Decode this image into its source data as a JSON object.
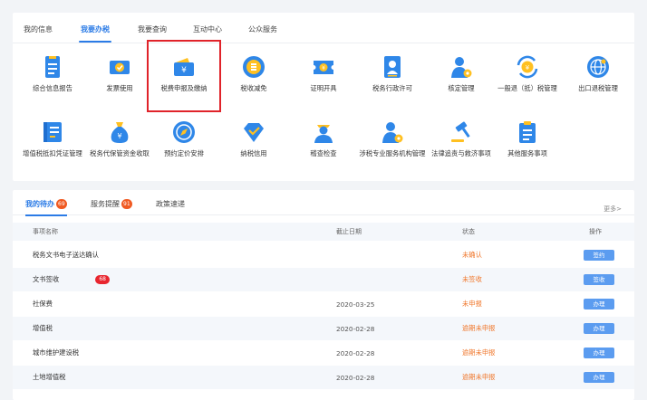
{
  "tabs": [
    "我的信息",
    "我要办税",
    "我要查询",
    "互动中心",
    "公众服务"
  ],
  "active_tab": 1,
  "services": [
    {
      "label": "综合信息报告",
      "icon": "report-doc-icon"
    },
    {
      "label": "发票使用",
      "icon": "invoice-icon"
    },
    {
      "label": "税费申报及缴纳",
      "icon": "wallet-yuan-icon"
    },
    {
      "label": "税收减免",
      "icon": "coin-stack-icon"
    },
    {
      "label": "证明开具",
      "icon": "certificate-icon"
    },
    {
      "label": "税务行政许可",
      "icon": "id-badge-icon"
    },
    {
      "label": "核定管理",
      "icon": "user-gear-icon"
    },
    {
      "label": "一般退（抵）税管理",
      "icon": "refund-yuan-icon"
    },
    {
      "label": "出口退税管理",
      "icon": "globe-icon"
    },
    {
      "label": "增值税抵扣凭证管理",
      "icon": "ledger-icon"
    },
    {
      "label": "税务代保管资金收取",
      "icon": "money-bag-icon"
    },
    {
      "label": "预约定价安排",
      "icon": "compass-icon"
    },
    {
      "label": "纳税信用",
      "icon": "diamond-check-icon"
    },
    {
      "label": "稽查检查",
      "icon": "inspector-icon"
    },
    {
      "label": "涉税专业服务机构管理",
      "icon": "agency-user-icon"
    },
    {
      "label": "法律追责与救济事项",
      "icon": "gavel-icon"
    },
    {
      "label": "其他服务事项",
      "icon": "clipboard-icon"
    }
  ],
  "colors": {
    "accent": "#2b7be6",
    "icon_blue": "#2f87e8",
    "icon_yellow": "#ffc021",
    "highlight": "#e0232a",
    "status_orange": "#f0782d",
    "badge_orange": "#f05a22",
    "button_blue": "#5b9cf0"
  },
  "bottom_tabs": [
    {
      "label": "我的待办",
      "badge": "69"
    },
    {
      "label": "服务提醒",
      "badge": "91"
    },
    {
      "label": "政策速递",
      "badge": ""
    }
  ],
  "more_label": "更多>",
  "table": {
    "headers": [
      "事项名称",
      "截止日期",
      "状态",
      "操作"
    ],
    "rows": [
      {
        "name": "税务文书电子送达确认",
        "count": "",
        "date": "",
        "status": "未确认",
        "action": "签约"
      },
      {
        "name": "文书签收",
        "count": "68",
        "date": "",
        "status": "未签收",
        "action": "签收"
      },
      {
        "name": "社保费",
        "count": "",
        "date": "2020-03-25",
        "status": "未申报",
        "action": "办理"
      },
      {
        "name": "增值税",
        "count": "",
        "date": "2020-02-28",
        "status": "逾期未申报",
        "action": "办理"
      },
      {
        "name": "城市维护建设税",
        "count": "",
        "date": "2020-02-28",
        "status": "逾期未申报",
        "action": "办理"
      },
      {
        "name": "土地增值税",
        "count": "",
        "date": "2020-02-28",
        "status": "逾期未申报",
        "action": "办理"
      }
    ]
  }
}
